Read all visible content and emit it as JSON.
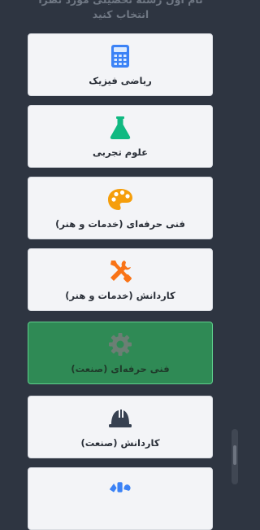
{
  "header": {
    "line1": "نام اول رشته تحصیلی مورد نظرا",
    "line2": "انتخاب کنید"
  },
  "fields": [
    {
      "label": "ریاضی فیزیک",
      "icon": "calculator-icon",
      "color": "#3b82f6",
      "selected": false
    },
    {
      "label": "علوم تجربی",
      "icon": "flask-icon",
      "color": "#10b981",
      "selected": false
    },
    {
      "label": "فنی حرفه‌ای (خدمات و هنر)",
      "icon": "palette-icon",
      "color": "#f59e0b",
      "selected": false
    },
    {
      "label": "کاردانش (خدمات و هنر)",
      "icon": "tools-icon",
      "color": "#f97316",
      "selected": false
    },
    {
      "label": "فنی حرفه‌ای (صنعت)",
      "icon": "gear-icon",
      "color": "#6b7280",
      "selected": true
    },
    {
      "label": "کاردانش (صنعت)",
      "icon": "hardhat-icon",
      "color": "#374151",
      "selected": false
    },
    {
      "label": "",
      "icon": "art-tools-icon",
      "color": "#3b82f6",
      "selected": false
    }
  ],
  "colors": {
    "background": "#2e3541",
    "card": "#f3f4f7",
    "selected_card": "#2f8a55",
    "selected_border": "#5fd08d"
  }
}
